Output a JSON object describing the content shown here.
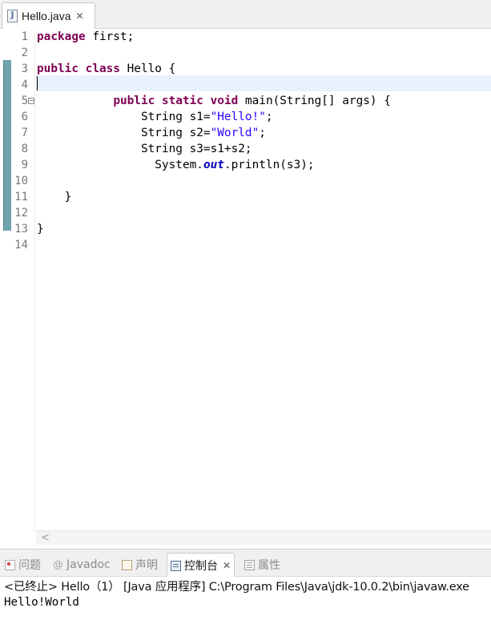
{
  "editor_tab": {
    "label": "Hello.java",
    "close": "✕",
    "icon": "java-file-icon"
  },
  "code": {
    "line_numbers": [
      "1",
      "2",
      "3",
      "4",
      "5",
      "6",
      "7",
      "8",
      "9",
      "10",
      "11",
      "12",
      "13",
      "14"
    ],
    "lines": [
      [
        [
          "kw",
          "package"
        ],
        [
          "",
          "first;"
        ]
      ],
      [],
      [
        [
          "kw",
          "public"
        ],
        [
          "",
          ""
        ],
        [
          "kw",
          "class"
        ],
        [
          "",
          "Hello {"
        ]
      ],
      [],
      [
        [
          "",
          "           "
        ],
        [
          "kw",
          "public"
        ],
        [
          "kw",
          "static"
        ],
        [
          "kw",
          "void"
        ],
        [
          "",
          "main(String[] args) {"
        ]
      ],
      [
        [
          "",
          "               String s1="
        ],
        [
          "str",
          "\"Hello!\""
        ],
        [
          "",
          ";"
        ]
      ],
      [
        [
          "",
          "               String s2="
        ],
        [
          "str",
          "\"World\""
        ],
        [
          "",
          ";"
        ]
      ],
      [
        [
          "",
          "               String s3=s1+s2;"
        ]
      ],
      [
        [
          "",
          "                 System."
        ],
        [
          "field",
          "out"
        ],
        [
          "",
          ".println(s3);"
        ]
      ],
      [],
      [
        [
          "",
          "    }"
        ]
      ],
      [],
      [
        [
          "",
          "}"
        ]
      ],
      []
    ],
    "current_line": 4,
    "fold_marker_line": 5
  },
  "panel": {
    "tabs": [
      {
        "label": "问题",
        "icon": "problems-icon",
        "active": false
      },
      {
        "label": "Javadoc",
        "icon": "javadoc-icon",
        "active": false
      },
      {
        "label": "声明",
        "icon": "declaration-icon",
        "active": false
      },
      {
        "label": "控制台",
        "icon": "console-icon",
        "active": true,
        "close": "✕"
      },
      {
        "label": "属性",
        "icon": "properties-icon",
        "active": false
      }
    ],
    "terminated_text": "<已终止> Hello（1） [Java 应用程序] C:\\Program Files\\Java\\jdk-10.0.2\\bin\\javaw.exe",
    "output": "Hello!World"
  },
  "colors": {
    "keyword": "#7f0055",
    "string": "#2a00ff",
    "field": "#0000c0",
    "current_line": "#e8f2fe"
  }
}
